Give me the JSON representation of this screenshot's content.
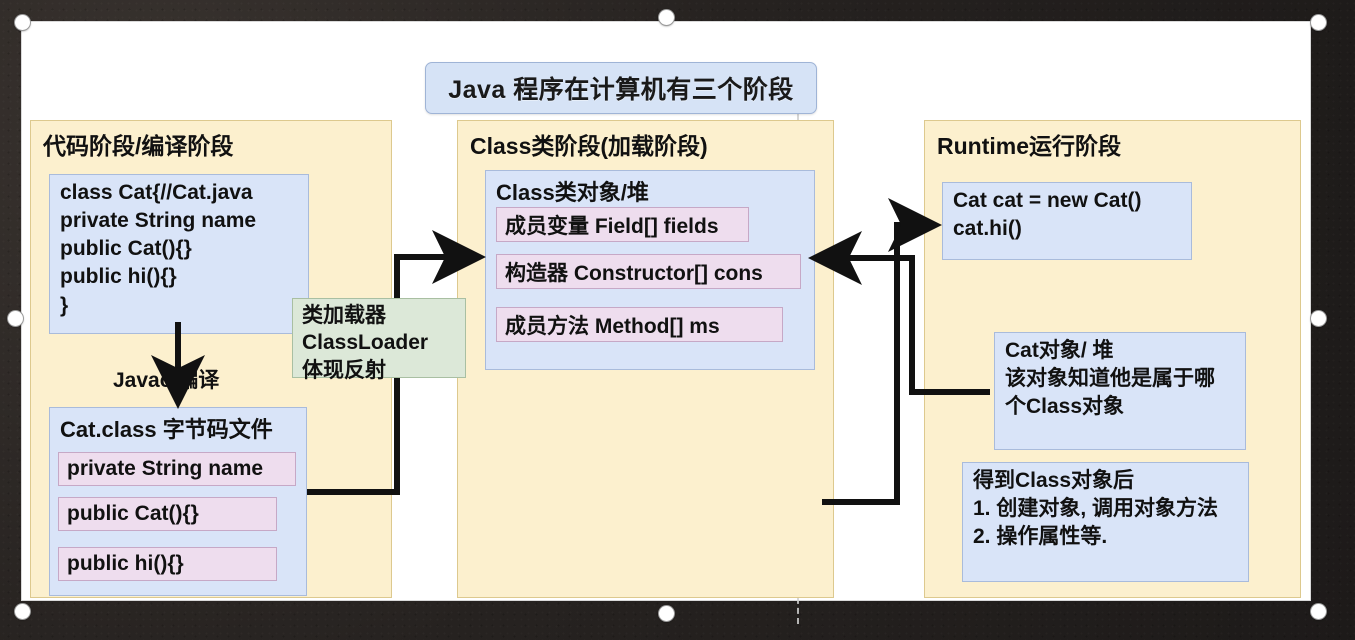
{
  "slide": {
    "title": "Java 程序在计算机有三个阶段"
  },
  "panels": {
    "code": {
      "heading": "代码阶段/编译阶段",
      "source_box": "class Cat{//Cat.java\nprivate String name\npublic Cat(){}\npublic hi(){}\n}",
      "compile_label": "Javac 编译",
      "class_file": {
        "heading": "Cat.class 字节码文件",
        "members": [
          "private String name",
          "public Cat(){}",
          "public hi(){}"
        ]
      }
    },
    "loader": {
      "text": "类加载器\nClassLoader\n体现反射"
    },
    "classstage": {
      "heading": "Class类阶段(加载阶段)",
      "object_box": {
        "heading": "Class类对象/堆",
        "members": [
          "成员变量 Field[] fields",
          "构造器 Constructor[] cons",
          "成员方法 Method[] ms"
        ]
      }
    },
    "runtime": {
      "heading": "Runtime运行阶段",
      "code_box": "Cat cat = new Cat()\ncat.hi()",
      "object_box": "Cat对象/ 堆\n该对象知道他是属于哪\n个Class对象",
      "usage_box": "得到Class对象后\n1. 创建对象, 调用对象方法\n2. 操作属性等."
    }
  },
  "colors": {
    "panel_fill": "#fcf0ce",
    "panel_border": "#ddc98e",
    "blue_fill": "#d9e4f8",
    "blue_border": "#a9bbdb",
    "pink_fill": "#eeddee",
    "pink_border": "#c6a8c6",
    "green_fill": "#dce8d8",
    "green_border": "#a9bfa2",
    "title_fill": "#d6e3f6",
    "arrow": "#111111",
    "canvas": "#ffffff",
    "backdrop": "#221f1e"
  }
}
